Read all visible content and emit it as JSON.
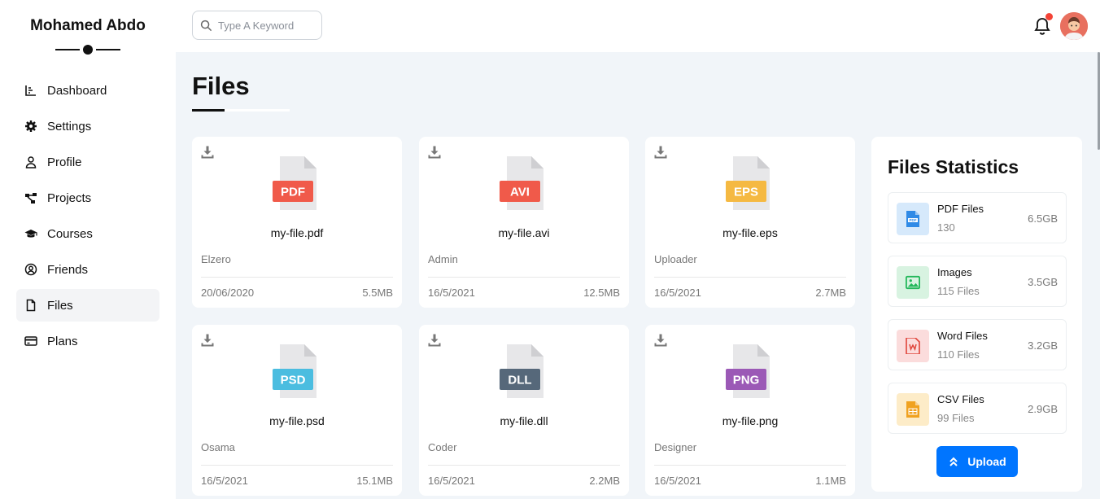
{
  "brand": {
    "name": "Mohamed Abdo"
  },
  "nav": [
    {
      "label": "Dashboard",
      "icon": "chart-icon"
    },
    {
      "label": "Settings",
      "icon": "gear-icon"
    },
    {
      "label": "Profile",
      "icon": "user-icon"
    },
    {
      "label": "Projects",
      "icon": "diagram-icon"
    },
    {
      "label": "Courses",
      "icon": "graduation-cap-icon"
    },
    {
      "label": "Friends",
      "icon": "user-circle-icon"
    },
    {
      "label": "Files",
      "icon": "file-icon",
      "active": true
    },
    {
      "label": "Plans",
      "icon": "credit-card-icon"
    }
  ],
  "header": {
    "search_placeholder": "Type A Keyword"
  },
  "page": {
    "title": "Files"
  },
  "files": [
    {
      "ext": "PDF",
      "color": "#f05a4a",
      "name": "my-file.pdf",
      "owner": "Elzero",
      "date": "20/06/2020",
      "size": "5.5MB"
    },
    {
      "ext": "AVI",
      "color": "#f05a4a",
      "name": "my-file.avi",
      "owner": "Admin",
      "date": "16/5/2021",
      "size": "12.5MB"
    },
    {
      "ext": "EPS",
      "color": "#f5b942",
      "name": "my-file.eps",
      "owner": "Uploader",
      "date": "16/5/2021",
      "size": "2.7MB"
    },
    {
      "ext": "PSD",
      "color": "#4bbde0",
      "name": "my-file.psd",
      "owner": "Osama",
      "date": "16/5/2021",
      "size": "15.1MB"
    },
    {
      "ext": "DLL",
      "color": "#56687a",
      "name": "my-file.dll",
      "owner": "Coder",
      "date": "16/5/2021",
      "size": "2.2MB"
    },
    {
      "ext": "PNG",
      "color": "#9b59b6",
      "name": "my-file.png",
      "owner": "Designer",
      "date": "16/5/2021",
      "size": "1.1MB"
    }
  ],
  "stats": {
    "title": "Files Statistics",
    "items": [
      {
        "name": "PDF Files",
        "count": "130",
        "size": "6.5GB",
        "bg": "#d6e9fb",
        "fg": "#2f8ae6",
        "icon": "pdf-file-icon"
      },
      {
        "name": "Images",
        "count": "115 Files",
        "size": "3.5GB",
        "bg": "#d8f3e1",
        "fg": "#22b85a",
        "icon": "image-icon"
      },
      {
        "name": "Word Files",
        "count": "110 Files",
        "size": "3.2GB",
        "bg": "#fbdcdc",
        "fg": "#e0443a",
        "icon": "word-file-icon"
      },
      {
        "name": "CSV Files",
        "count": "99 Files",
        "size": "2.9GB",
        "bg": "#fdecc8",
        "fg": "#f0a220",
        "icon": "csv-file-icon"
      }
    ],
    "upload_label": "Upload"
  }
}
